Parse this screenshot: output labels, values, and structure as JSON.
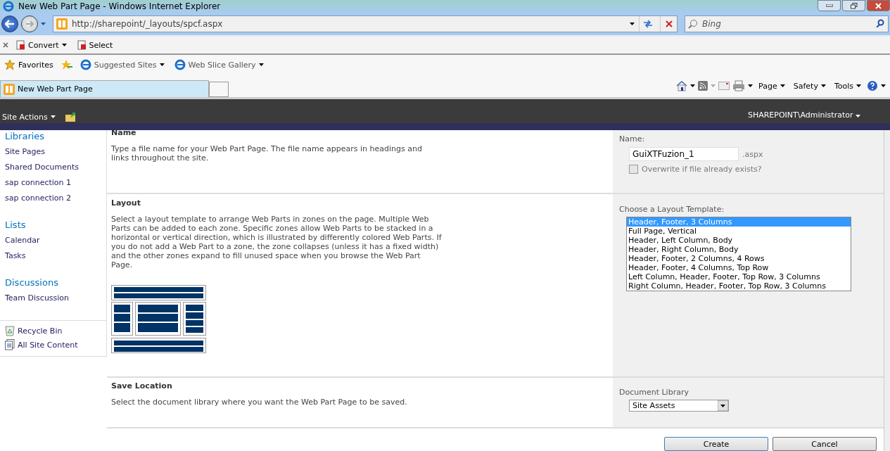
{
  "window": {
    "title": "New Web Part Page - Windows Internet Explorer"
  },
  "address_bar": {
    "url": "http://sharepoint/_layouts/spcf.aspx"
  },
  "search": {
    "placeholder": "Bing"
  },
  "command_bar": [
    "Convert",
    "Select"
  ],
  "favorites_bar": {
    "favorites": "Favorites",
    "links": [
      "Suggested Sites",
      "Web Slice Gallery"
    ]
  },
  "tabs": [
    {
      "label": "New Web Part Page",
      "selected": true
    }
  ],
  "ie_toolbar": [
    "Page",
    "Safety",
    "Tools"
  ],
  "site_bar": {
    "site_actions": "Site Actions",
    "user": "SHAREPOINT\\Administrator"
  },
  "sidebar": {
    "groups": [
      {
        "heading": "Libraries",
        "items": [
          "Site Pages",
          "Shared Documents",
          "sap connection 1",
          "sap connection 2"
        ]
      },
      {
        "heading": "Lists",
        "items": [
          "Calendar",
          "Tasks"
        ]
      },
      {
        "heading": "Discussions",
        "items": [
          "Team Discussion"
        ]
      }
    ],
    "footer_items": [
      {
        "kind": "recycle",
        "label": "Recycle Bin"
      },
      {
        "kind": "content",
        "label": "All Site Content"
      }
    ]
  },
  "sections": [
    {
      "kind": "name",
      "title": "Name",
      "description": "Type a file name for your Web Part Page.  The file name appears in headings and links throughout the site.",
      "field_label": "Name:",
      "value": "GuiXTFuzion_1",
      "suffix": ".aspx",
      "overwrite": {
        "label": "Overwrite if file already exists?",
        "checked": false
      }
    },
    {
      "kind": "layout",
      "title": "Layout",
      "description": "Select a layout template to arrange Web Parts in zones on the page. Multiple Web Parts can be added to each zone. Specific zones allow Web Parts to be stacked in a horizontal or vertical direction, which is illustrated by differently colored Web Parts. If you do not add a Web Part to a zone, the zone collapses (unless it has a fixed width) and the other zones expand to fill unused space when you browse the Web Part Page.",
      "field_label": "Choose a Layout Template:",
      "options": [
        {
          "label": "Header, Footer, 3 Columns",
          "selected": true
        },
        {
          "label": "Full Page, Vertical",
          "selected": false
        },
        {
          "label": "Header, Left Column, Body",
          "selected": false
        },
        {
          "label": "Header, Right Column, Body",
          "selected": false
        },
        {
          "label": "Header, Footer, 2 Columns, 4 Rows",
          "selected": false
        },
        {
          "label": "Header, Footer, 4 Columns, Top Row",
          "selected": false
        },
        {
          "label": "Left Column, Header, Footer, Top Row, 3 Columns",
          "selected": false
        },
        {
          "label": "Right Column, Header, Footer, Top Row, 3 Columns",
          "selected": false
        }
      ]
    },
    {
      "kind": "save",
      "title": "Save Location",
      "description": "Select the document library where you want the Web Part Page to be saved.",
      "field_label": "Document Library",
      "value": "Site Assets"
    }
  ],
  "buttons": [
    {
      "label": "Create",
      "default": true
    },
    {
      "label": "Cancel",
      "default": false
    }
  ]
}
